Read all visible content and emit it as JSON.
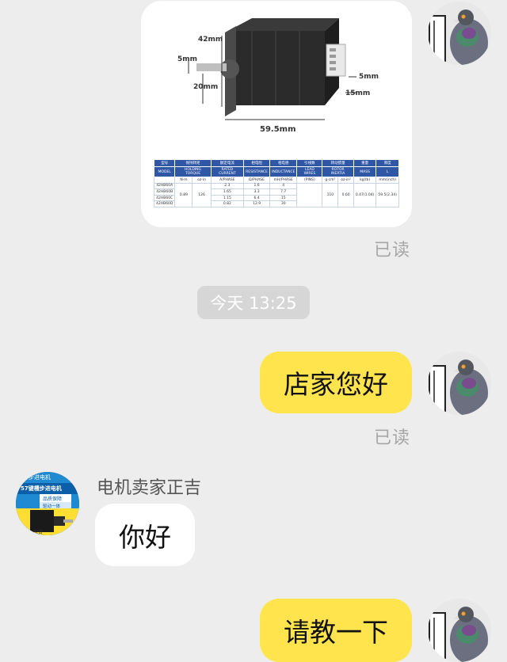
{
  "messages": {
    "read_label_1": "已读",
    "timestamp": "今天 13:25",
    "me_msg_1": "店家您好",
    "read_label_2": "已读",
    "seller_name": "电机卖家正吉",
    "seller_msg_1": "你好",
    "me_msg_2": "请教一下"
  },
  "product_image": {
    "dim_42": "42mm",
    "dim_5a": "5mm",
    "dim_20": "20mm",
    "dim_59": "59.5mm",
    "dim_5b": "5mm",
    "dim_15": "15mm",
    "table_headers": [
      "型号",
      "保持转矩",
      "额定电流",
      "相电阻",
      "相电感",
      "引线数",
      "转动惯量",
      "重量",
      "厚度"
    ],
    "table_subheaders": [
      "MODEL",
      "HOLDING TORQUE",
      "RATED CURRENT",
      "RESISTANCE",
      "INDUCTANCE",
      "LEAD WIRES",
      "ROTOR INERTIA",
      "MASS",
      "L"
    ],
    "table_units": [
      "",
      "N·m",
      "oz-in",
      "A/PHASE",
      "Ω/PHASE",
      "mH/PHASE",
      "(PINS)",
      "g·cm²",
      "oz-in²",
      "kg(lb)",
      "mm(inch)"
    ],
    "rows": [
      {
        "model": "42HB60A",
        "current": "2.3",
        "resist": "1.6",
        "induct": "4"
      },
      {
        "model": "42HB60B",
        "current": "1.65",
        "resist": "3.3",
        "induct": "7.7"
      },
      {
        "model": "42HB60C",
        "current": "1.15",
        "resist": "6.4",
        "induct": "15"
      },
      {
        "model": "42HB60D",
        "current": "0.82",
        "resist": "12.9",
        "induct": "30"
      }
    ],
    "torque_nm": "0.89",
    "torque_oz": "126",
    "inertia_g": "110",
    "inertia_oz": "0.60",
    "mass": "0.47(1.04)",
    "length": "59.5(2.34)"
  },
  "seller_avatar": {
    "line1": "步进电机",
    "line2": "57键槽步进电机",
    "line3": "品质保障",
    "line4": "驱动一体",
    "line5": "现货"
  },
  "colors": {
    "background": "#ededed",
    "my_bubble": "#ffe44d",
    "other_bubble": "#ffffff",
    "read_text": "#a6a6a6",
    "table_header": "#2f57a6"
  }
}
